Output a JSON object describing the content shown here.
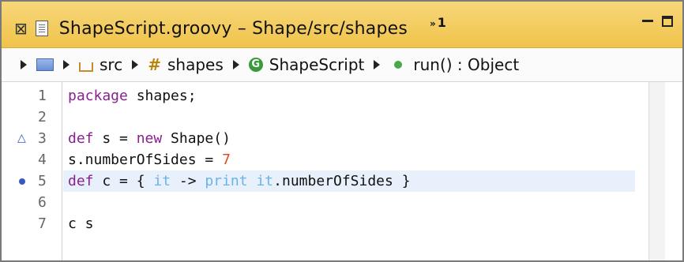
{
  "editor_tab": {
    "close_glyph": "⊠",
    "title": "ShapeScript.groovy – Shape/src/shapes",
    "overflow_count": "1"
  },
  "breadcrumb": {
    "items": [
      {
        "label": "",
        "icon": "project-icon"
      },
      {
        "label": "src",
        "icon": "source-folder-icon"
      },
      {
        "label": "shapes",
        "icon": "package-icon"
      },
      {
        "label": "ShapeScript",
        "icon": "class-icon"
      },
      {
        "label": "run() : Object",
        "icon": "method-icon"
      }
    ]
  },
  "code": {
    "lines": [
      {
        "number": "1",
        "tokens": [
          {
            "t": "package",
            "c": "kw"
          },
          {
            "t": " shapes;",
            "c": "pl"
          }
        ]
      },
      {
        "number": "2",
        "tokens": []
      },
      {
        "number": "3",
        "tokens": [
          {
            "t": "def",
            "c": "kw"
          },
          {
            "t": " s = ",
            "c": "pl"
          },
          {
            "t": "new",
            "c": "kw"
          },
          {
            "t": " Shape()",
            "c": "pl"
          }
        ]
      },
      {
        "number": "4",
        "tokens": [
          {
            "t": "s.numberOfSides = ",
            "c": "pl"
          },
          {
            "t": "7",
            "c": "num"
          }
        ]
      },
      {
        "number": "5",
        "tokens": [
          {
            "t": "def",
            "c": "kw"
          },
          {
            "t": " c = { ",
            "c": "pl"
          },
          {
            "t": "it",
            "c": "it"
          },
          {
            "t": " -> ",
            "c": "pl"
          },
          {
            "t": "print",
            "c": "it"
          },
          {
            "t": " ",
            "c": "pl"
          },
          {
            "t": "it",
            "c": "it"
          },
          {
            "t": ".numberOfSides }",
            "c": "pl"
          }
        ]
      },
      {
        "number": "6",
        "tokens": []
      },
      {
        "number": "7",
        "tokens": [
          {
            "t": "c s",
            "c": "pl"
          }
        ]
      }
    ],
    "current_line": 5
  },
  "markers": {
    "line3": "△",
    "line5": "occurrence-marker"
  },
  "colors": {
    "keyword": "#8a1f8f",
    "number": "#e24b1f",
    "builtin": "#6ab3e8",
    "title_bar": "#f0c44b"
  }
}
